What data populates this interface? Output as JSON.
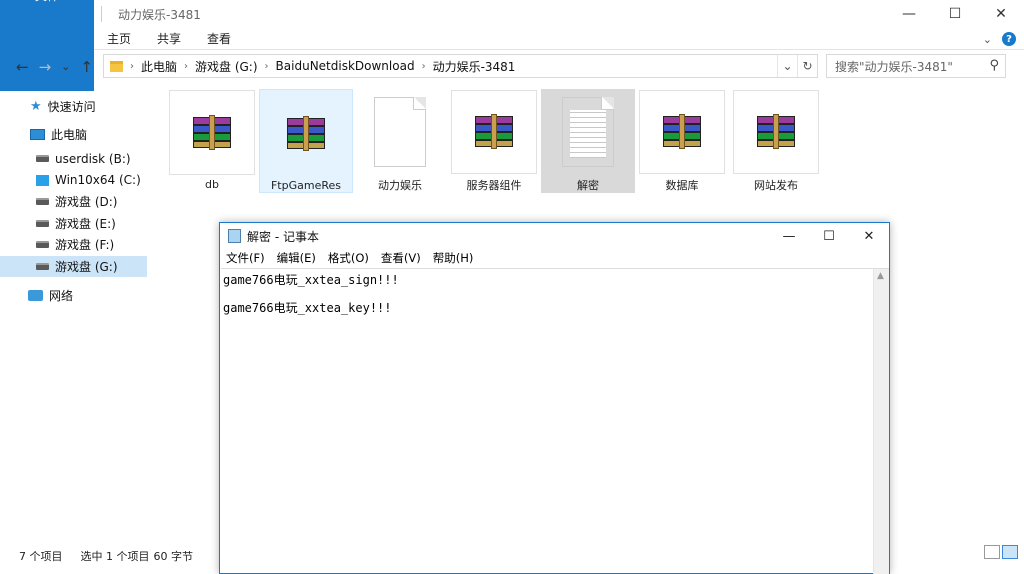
{
  "explorer": {
    "title": "动力娱乐-3481",
    "window_controls": {
      "minimize": "—",
      "maximize": "☐",
      "close": "✕"
    },
    "ribbon": {
      "tabs": [
        "文件",
        "主页",
        "共享",
        "查看"
      ],
      "expand_glyph": "⌄",
      "help_glyph": "?"
    },
    "nav": {
      "back": "←",
      "forward": "→",
      "recent": "⌄",
      "up": "↑"
    },
    "address": {
      "crumbs": [
        "此电脑",
        "游戏盘 (G:)",
        "BaiduNetdiskDownload",
        "动力娱乐-3481"
      ],
      "dropdown": "⌄",
      "refresh": "↻"
    },
    "search": {
      "placeholder": "搜索\"动力娱乐-3481\"",
      "icon": "⚲"
    },
    "sidebar": {
      "quick_access": "快速访问",
      "this_pc": "此电脑",
      "drives": [
        "userdisk (B:)",
        "Win10x64 (C:)",
        "游戏盘 (D:)",
        "游戏盘 (E:)",
        "游戏盘 (F:)",
        "游戏盘 (G:)"
      ],
      "network": "网络"
    },
    "files": [
      {
        "name": "db",
        "icon": "winrar-archive-icon"
      },
      {
        "name": "FtpGameRes",
        "icon": "winrar-archive-icon"
      },
      {
        "name": "动力娱乐",
        "icon": "blank-file-icon"
      },
      {
        "name": "服务器组件",
        "icon": "winrar-archive-icon"
      },
      {
        "name": "解密",
        "icon": "text-file-icon"
      },
      {
        "name": "数据库",
        "icon": "winrar-archive-icon"
      },
      {
        "name": "网站发布",
        "icon": "winrar-archive-icon"
      }
    ],
    "status": {
      "count": "7 个项目",
      "selection": "选中 1 个项目",
      "size": "60 字节"
    }
  },
  "notepad": {
    "title": "解密 - 记事本",
    "window_controls": {
      "minimize": "—",
      "maximize": "☐",
      "close": "✕"
    },
    "menu": [
      "文件(F)",
      "编辑(E)",
      "格式(O)",
      "查看(V)",
      "帮助(H)"
    ],
    "content": "game766电玩_xxtea_sign!!!\n\ngame766电玩_xxtea_key!!!",
    "scroll_up": "▲"
  },
  "colors": {
    "accent": "#1979ca",
    "selection": "#cce4f7",
    "selected_file": "#d9d9d9"
  }
}
